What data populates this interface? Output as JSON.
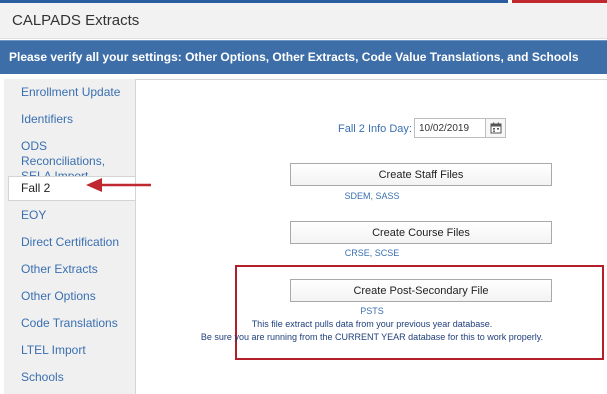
{
  "header": {
    "title": "CALPADS Extracts"
  },
  "banner": {
    "text": "Please verify all your settings: Other Options, Other Extracts, Code Value Translations, and Schools"
  },
  "sidebar": {
    "items": [
      {
        "label": "Enrollment Update"
      },
      {
        "label": "Identifiers"
      },
      {
        "label": "ODS Reconciliations, SELA Import"
      },
      {
        "label": "Fall 2",
        "active": true
      },
      {
        "label": "EOY"
      },
      {
        "label": "Direct Certification"
      },
      {
        "label": "Other Extracts"
      },
      {
        "label": "Other Options"
      },
      {
        "label": "Code Translations"
      },
      {
        "label": "LTEL Import"
      },
      {
        "label": "Schools"
      }
    ]
  },
  "main": {
    "info_day_label": "Fall 2 Info Day:",
    "info_day_value": "10/02/2019",
    "staff": {
      "button": "Create Staff Files",
      "sub": "SDEM, SASS"
    },
    "course": {
      "button": "Create Course Files",
      "sub": "CRSE, SCSE"
    },
    "postsec": {
      "button": "Create Post-Secondary File",
      "sub": "PSTS",
      "note1": "This file extract pulls data from your previous year database.",
      "note2": "Be sure you are running from the CURRENT YEAR database for this to work properly."
    }
  },
  "colors": {
    "banner": "#3d6ea8",
    "link": "#3a6fb0",
    "highlight": "#b21f2a"
  },
  "icons": {
    "calendar": "calendar-icon",
    "arrow": "red-arrow-icon"
  }
}
